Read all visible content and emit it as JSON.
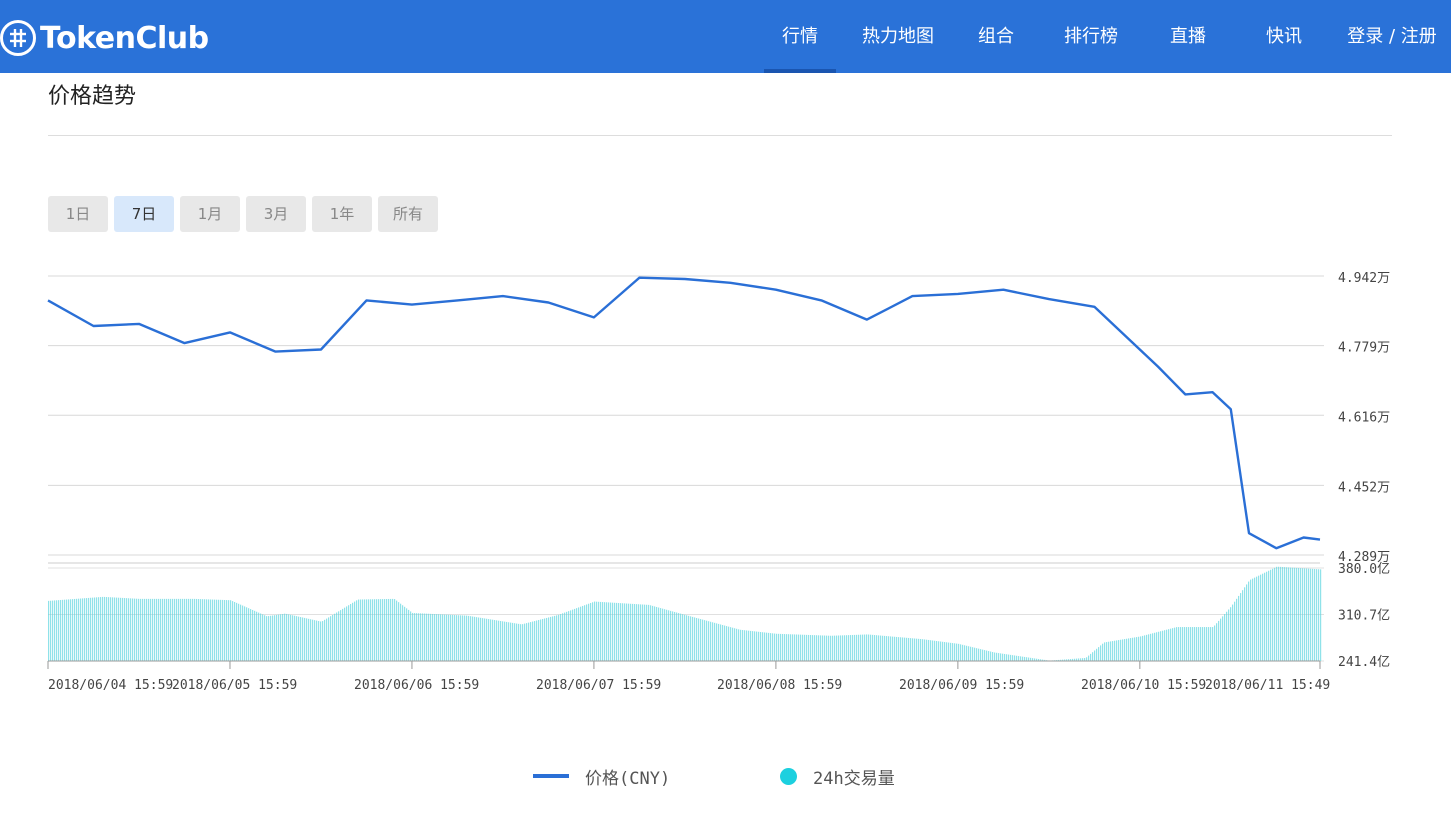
{
  "header": {
    "brand": "TokenClub",
    "nav": [
      {
        "label": "行情",
        "active": true
      },
      {
        "label": "热力地图",
        "active": false
      },
      {
        "label": "组合",
        "active": false
      },
      {
        "label": "排行榜",
        "active": false
      },
      {
        "label": "直播",
        "active": false
      },
      {
        "label": "快讯",
        "active": false
      },
      {
        "label": "登录 / 注册",
        "active": false
      }
    ]
  },
  "section": {
    "title": "价格趋势"
  },
  "ranges": [
    {
      "label": "1日",
      "active": false
    },
    {
      "label": "7日",
      "active": true
    },
    {
      "label": "1月",
      "active": false
    },
    {
      "label": "3月",
      "active": false
    },
    {
      "label": "1年",
      "active": false
    },
    {
      "label": "所有",
      "active": false
    }
  ],
  "colors": {
    "header": "#2a72d8",
    "price_line": "#2a6fd6",
    "volume_bar": "#5fd6e0"
  },
  "chart_data": {
    "type": "line",
    "title": "",
    "x_ticks": [
      "2018/06/04 15:59",
      "2018/06/05 15:59",
      "2018/06/06 15:59",
      "2018/06/07 15:59",
      "2018/06/08 15:59",
      "2018/06/09 15:59",
      "2018/06/10 15:59",
      "2018/06/11 15:49"
    ],
    "price_ticks": [
      "4.942万",
      "4.779万",
      "4.616万",
      "4.452万",
      "4.289万"
    ],
    "volume_ticks": [
      "380.0亿",
      "310.7亿",
      "241.4亿"
    ],
    "price_range": [
      42890,
      49420
    ],
    "volume_range": [
      24140,
      38000
    ],
    "series": [
      {
        "name": "价格(CNY)",
        "unit": "CNY",
        "x": [
          0,
          0.25,
          0.5,
          0.75,
          1,
          1.25,
          1.5,
          1.75,
          2,
          2.25,
          2.5,
          2.75,
          3,
          3.25,
          3.5,
          3.75,
          4,
          4.25,
          4.5,
          4.75,
          5,
          5.25,
          5.5,
          5.75,
          6,
          6.1,
          6.25,
          6.4,
          6.5,
          6.6,
          6.75,
          6.9,
          6.99
        ],
        "values": [
          48850,
          48250,
          48300,
          47850,
          48100,
          47650,
          47700,
          48850,
          48750,
          48850,
          48950,
          48800,
          48450,
          49380,
          49350,
          49260,
          49100,
          48850,
          48400,
          48950,
          49000,
          49100,
          48880,
          48700,
          47700,
          47300,
          46650,
          46700,
          46300,
          43400,
          43050,
          43300,
          43250
        ]
      },
      {
        "name": "24h交易量",
        "unit": "亿",
        "x": [
          0,
          0.3,
          0.5,
          0.8,
          1.0,
          1.2,
          1.3,
          1.5,
          1.7,
          1.9,
          2.0,
          2.3,
          2.6,
          2.8,
          3.0,
          3.3,
          3.5,
          3.8,
          4.0,
          4.3,
          4.5,
          4.8,
          5.0,
          5.2,
          5.5,
          5.7,
          5.8,
          6.0,
          6.2,
          6.4,
          6.5,
          6.6,
          6.75,
          6.99
        ],
        "values": [
          33100,
          33700,
          33400,
          33400,
          33200,
          30800,
          31200,
          30000,
          33300,
          33400,
          31300,
          30900,
          29600,
          31000,
          33000,
          32500,
          31000,
          28800,
          28200,
          27900,
          28100,
          27400,
          26700,
          25400,
          24200,
          24600,
          26900,
          27800,
          29200,
          29200,
          32300,
          36200,
          38200,
          37800
        ]
      }
    ],
    "grid": true,
    "legend_position": "bottom-center"
  }
}
